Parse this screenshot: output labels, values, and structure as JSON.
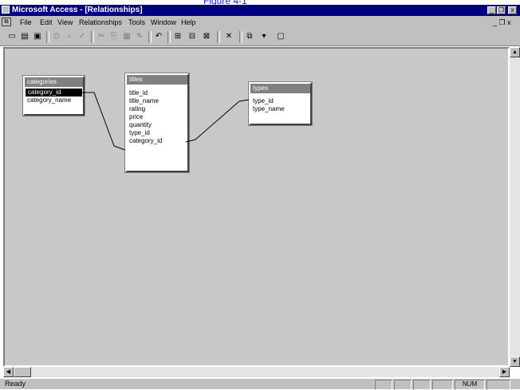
{
  "caption_link": "Figure 4-1",
  "window": {
    "title": "Microsoft Access - [Relationships]",
    "controls": {
      "minimize": "_",
      "restore": "❐",
      "close": "x"
    }
  },
  "menu": {
    "items": [
      "File",
      "Edit",
      "View",
      "Relationships",
      "Tools",
      "Window",
      "Help"
    ],
    "doc_controls": "_ ❐ x"
  },
  "toolbar": {
    "buttons": [
      "view",
      "save",
      "print",
      "print-preview",
      "spelling",
      "cut",
      "copy",
      "paste",
      "format-painter",
      "undo",
      "show-table",
      "show-direct",
      "show-all",
      "delete",
      "new-object",
      "help"
    ]
  },
  "tables": [
    {
      "name": "categories",
      "fields": [
        "category_id",
        "category_name"
      ],
      "selected_field": 0
    },
    {
      "name": "titles",
      "fields": [
        "title_id",
        "title_name",
        "rating",
        "price",
        "quantity",
        "type_id",
        "category_id"
      ],
      "selected_field": -1
    },
    {
      "name": "types",
      "fields": [
        "type_id",
        "type_name"
      ],
      "selected_field": -1
    }
  ],
  "status": {
    "text": "Ready",
    "panels": [
      "",
      "",
      "",
      "",
      "NUM",
      ""
    ]
  }
}
